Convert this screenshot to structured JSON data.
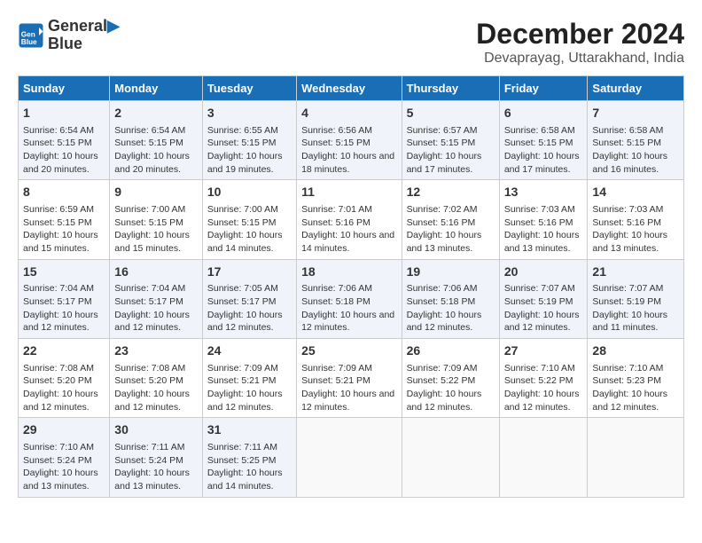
{
  "logo": {
    "line1": "General",
    "line2": "Blue"
  },
  "title": "December 2024",
  "subtitle": "Devaprayag, Uttarakhand, India",
  "days_of_week": [
    "Sunday",
    "Monday",
    "Tuesday",
    "Wednesday",
    "Thursday",
    "Friday",
    "Saturday"
  ],
  "weeks": [
    [
      {
        "day": "1",
        "sunrise": "6:54 AM",
        "sunset": "5:15 PM",
        "daylight": "10 hours and 20 minutes."
      },
      {
        "day": "2",
        "sunrise": "6:54 AM",
        "sunset": "5:15 PM",
        "daylight": "10 hours and 20 minutes."
      },
      {
        "day": "3",
        "sunrise": "6:55 AM",
        "sunset": "5:15 PM",
        "daylight": "10 hours and 19 minutes."
      },
      {
        "day": "4",
        "sunrise": "6:56 AM",
        "sunset": "5:15 PM",
        "daylight": "10 hours and 18 minutes."
      },
      {
        "day": "5",
        "sunrise": "6:57 AM",
        "sunset": "5:15 PM",
        "daylight": "10 hours and 17 minutes."
      },
      {
        "day": "6",
        "sunrise": "6:58 AM",
        "sunset": "5:15 PM",
        "daylight": "10 hours and 17 minutes."
      },
      {
        "day": "7",
        "sunrise": "6:58 AM",
        "sunset": "5:15 PM",
        "daylight": "10 hours and 16 minutes."
      }
    ],
    [
      {
        "day": "8",
        "sunrise": "6:59 AM",
        "sunset": "5:15 PM",
        "daylight": "10 hours and 15 minutes."
      },
      {
        "day": "9",
        "sunrise": "7:00 AM",
        "sunset": "5:15 PM",
        "daylight": "10 hours and 15 minutes."
      },
      {
        "day": "10",
        "sunrise": "7:00 AM",
        "sunset": "5:15 PM",
        "daylight": "10 hours and 14 minutes."
      },
      {
        "day": "11",
        "sunrise": "7:01 AM",
        "sunset": "5:16 PM",
        "daylight": "10 hours and 14 minutes."
      },
      {
        "day": "12",
        "sunrise": "7:02 AM",
        "sunset": "5:16 PM",
        "daylight": "10 hours and 13 minutes."
      },
      {
        "day": "13",
        "sunrise": "7:03 AM",
        "sunset": "5:16 PM",
        "daylight": "10 hours and 13 minutes."
      },
      {
        "day": "14",
        "sunrise": "7:03 AM",
        "sunset": "5:16 PM",
        "daylight": "10 hours and 13 minutes."
      }
    ],
    [
      {
        "day": "15",
        "sunrise": "7:04 AM",
        "sunset": "5:17 PM",
        "daylight": "10 hours and 12 minutes."
      },
      {
        "day": "16",
        "sunrise": "7:04 AM",
        "sunset": "5:17 PM",
        "daylight": "10 hours and 12 minutes."
      },
      {
        "day": "17",
        "sunrise": "7:05 AM",
        "sunset": "5:17 PM",
        "daylight": "10 hours and 12 minutes."
      },
      {
        "day": "18",
        "sunrise": "7:06 AM",
        "sunset": "5:18 PM",
        "daylight": "10 hours and 12 minutes."
      },
      {
        "day": "19",
        "sunrise": "7:06 AM",
        "sunset": "5:18 PM",
        "daylight": "10 hours and 12 minutes."
      },
      {
        "day": "20",
        "sunrise": "7:07 AM",
        "sunset": "5:19 PM",
        "daylight": "10 hours and 12 minutes."
      },
      {
        "day": "21",
        "sunrise": "7:07 AM",
        "sunset": "5:19 PM",
        "daylight": "10 hours and 11 minutes."
      }
    ],
    [
      {
        "day": "22",
        "sunrise": "7:08 AM",
        "sunset": "5:20 PM",
        "daylight": "10 hours and 12 minutes."
      },
      {
        "day": "23",
        "sunrise": "7:08 AM",
        "sunset": "5:20 PM",
        "daylight": "10 hours and 12 minutes."
      },
      {
        "day": "24",
        "sunrise": "7:09 AM",
        "sunset": "5:21 PM",
        "daylight": "10 hours and 12 minutes."
      },
      {
        "day": "25",
        "sunrise": "7:09 AM",
        "sunset": "5:21 PM",
        "daylight": "10 hours and 12 minutes."
      },
      {
        "day": "26",
        "sunrise": "7:09 AM",
        "sunset": "5:22 PM",
        "daylight": "10 hours and 12 minutes."
      },
      {
        "day": "27",
        "sunrise": "7:10 AM",
        "sunset": "5:22 PM",
        "daylight": "10 hours and 12 minutes."
      },
      {
        "day": "28",
        "sunrise": "7:10 AM",
        "sunset": "5:23 PM",
        "daylight": "10 hours and 12 minutes."
      }
    ],
    [
      {
        "day": "29",
        "sunrise": "7:10 AM",
        "sunset": "5:24 PM",
        "daylight": "10 hours and 13 minutes."
      },
      {
        "day": "30",
        "sunrise": "7:11 AM",
        "sunset": "5:24 PM",
        "daylight": "10 hours and 13 minutes."
      },
      {
        "day": "31",
        "sunrise": "7:11 AM",
        "sunset": "5:25 PM",
        "daylight": "10 hours and 14 minutes."
      },
      null,
      null,
      null,
      null
    ]
  ]
}
